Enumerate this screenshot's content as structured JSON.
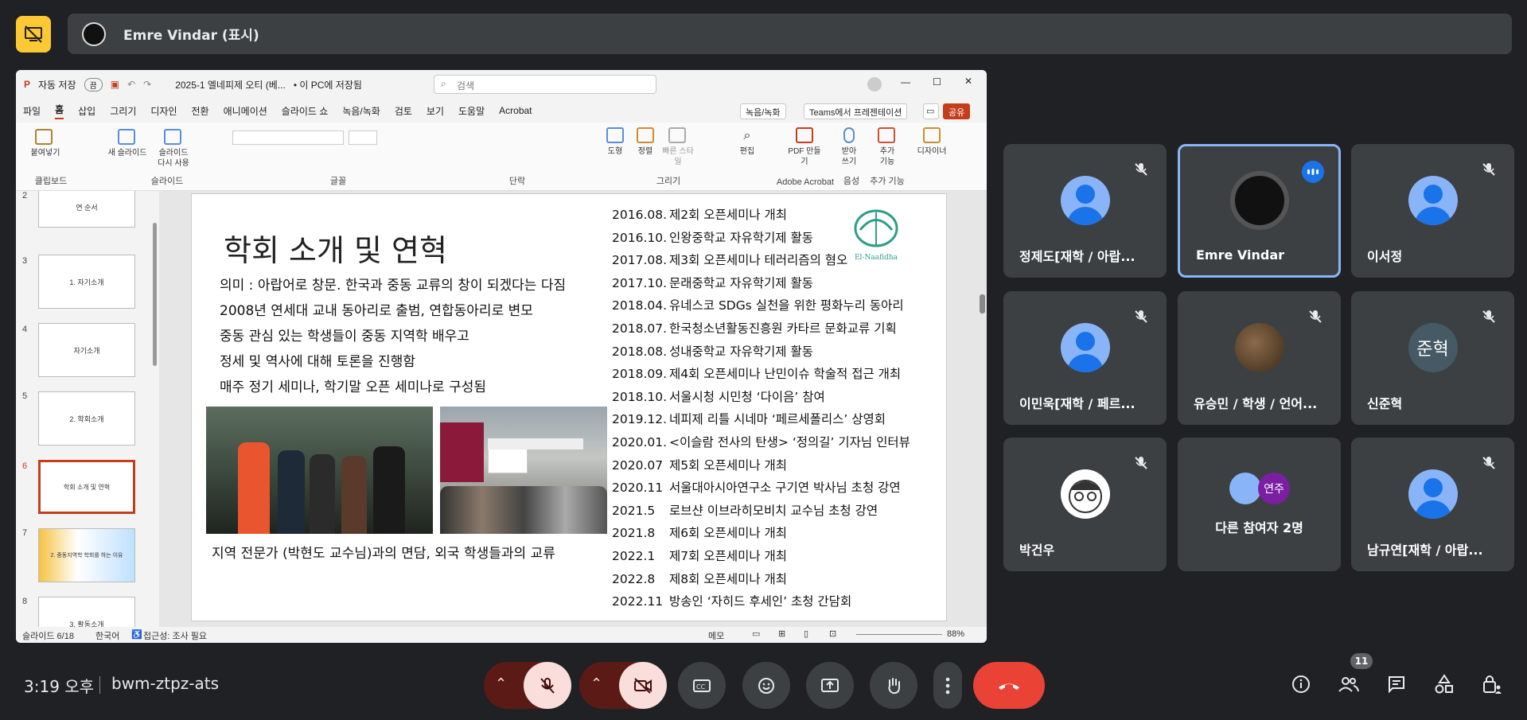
{
  "meeting": {
    "presenter_label": "Emre Vindar (표시)",
    "time": "3:19 오후",
    "code": "bwm-ztpz-ats",
    "participant_count": "11"
  },
  "ppt": {
    "autosave": "자동 저장",
    "autosave_toggle": "끔",
    "file_name": "2025-1 엘네피제 오티 (베...",
    "save_location": "• 이 PC에 저장됨",
    "search_placeholder": "검색",
    "menu": [
      "파일",
      "홈",
      "삽입",
      "그리기",
      "디자인",
      "전환",
      "애니메이션",
      "슬라이드 쇼",
      "녹음/녹화",
      "검토",
      "보기",
      "도움말",
      "Acrobat"
    ],
    "record_btn": "녹음/녹화",
    "teams_btn": "Teams에서 프레젠테이션",
    "share_btn": "공유",
    "ribbon": {
      "paste": "붙여넣기",
      "new_slide": "새 슬라이드",
      "reuse_slide": "슬라이드 다시 사용",
      "group_clipboard": "클립보드",
      "group_slide": "슬라이드",
      "group_font": "글꼴",
      "group_paragraph": "단락",
      "shapes": "도형",
      "arrange": "정렬",
      "quick_styles": "빠른 스타일",
      "group_drawing": "그리기",
      "editing": "편집",
      "pdf_share": "PDF 만들기",
      "group_acrobat": "Adobe Acrobat",
      "dictate": "받아 쓰기",
      "group_voice": "음성",
      "addins": "추가 기능",
      "group_addins": "추가 기능",
      "designer": "디자이너"
    },
    "thumbs": [
      {
        "num": "2",
        "text": "연 순서"
      },
      {
        "num": "3",
        "text": "1. 자기소개"
      },
      {
        "num": "4",
        "text": "자기소개"
      },
      {
        "num": "5",
        "text": "2. 학회소개"
      },
      {
        "num": "6",
        "text": "학회 소개 및 연혁"
      },
      {
        "num": "7",
        "text": "2. 중동지역학 학회를 하는 이유"
      },
      {
        "num": "8",
        "text": "3. 활동소개"
      }
    ],
    "status": {
      "slide": "슬라이드 6/18",
      "lang": "한국어",
      "access": "접근성: 조사 필요",
      "notes": "메모",
      "zoom": "88%"
    }
  },
  "slide": {
    "title": "학회 소개 및 연혁",
    "desc": [
      "의미 : 아랍어로 창문. 한국과 중동 교류의 창이 되겠다는 다짐",
      "2008년 연세대 교내 동아리로 출범, 연합동아리로 변모",
      "중동 관심 있는 학생들이 중동 지역학 배우고",
      "정세 및 역사에 대해 토론을 진행함",
      "매주 정기 세미나, 학기말 오픈 세미나로 구성됨"
    ],
    "caption": "지역 전문가 (박현도 교수님)과의 면담, 외국 학생들과의 교류",
    "logo_text": "El-Naafidha",
    "timeline": [
      {
        "date": "2016.08.",
        "event": "제2회 오픈세미나 개최"
      },
      {
        "date": "2016.10.",
        "event": "인왕중학교 자유학기제 활동"
      },
      {
        "date": "2017.08.",
        "event": "제3회 오픈세미나 테러리즘의 혐오"
      },
      {
        "date": "2017.10.",
        "event": "문래중학교 자유학기제 활동"
      },
      {
        "date": "2018.04.",
        "event": "유네스코 SDGs 실천을 위한 평화누리 동아리"
      },
      {
        "date": "2018.07.",
        "event": "한국청소년활동진흥원 카타르 문화교류 기획"
      },
      {
        "date": "2018.08.",
        "event": "성내중학교 자유학기제 활동"
      },
      {
        "date": "2018.09.",
        "event": "제4회 오픈세미나 난민이슈 학술적 접근 개최"
      },
      {
        "date": "2018.10.",
        "event": "서울시청 시민청 ‘다이음’ 참여"
      },
      {
        "date": "2019.12.",
        "event": "네피제 리틀 시네마 ‘페르세폴리스’ 상영회"
      },
      {
        "date": "2020.01.",
        "event": "<이슬람 전사의 탄생> ‘정의길’ 기자님 인터뷰"
      },
      {
        "date": "2020.07",
        "event": "제5회 오픈세미나 개최"
      },
      {
        "date": "2020.11",
        "event": "서울대아시아연구소 구기연 박사님 초청 강연"
      },
      {
        "date": "2021.5",
        "event": "로브샨 이브라히모비치 교수님 초청 강연"
      },
      {
        "date": "2021.8",
        "event": "제6회 오픈세미나 개최"
      },
      {
        "date": "2022.1",
        "event": "제7회 오픈세미나 개최"
      },
      {
        "date": "2022.8",
        "event": "제8회 오픈세미나 개최"
      },
      {
        "date": "2022.11",
        "event": "방송인 ‘자히드 후세인’ 초청 간담회"
      }
    ]
  },
  "participants": [
    {
      "name": "정제도[재학 / 아랍...",
      "muted": true
    },
    {
      "name": "Emre Vindar",
      "muted": false
    },
    {
      "name": "이서정",
      "muted": true
    },
    {
      "name": "이민욱[재학 / 페르...",
      "muted": true
    },
    {
      "name": "유승민 / 학생 / 언어...",
      "muted": true
    },
    {
      "name": "신준혁",
      "muted": true,
      "initial": "준혁"
    },
    {
      "name": "박건우",
      "muted": true
    },
    {
      "name": "다른 참여자 2명",
      "muted": false,
      "badge": "연주"
    },
    {
      "name": "남규연[재학 / 아랍...",
      "muted": true
    }
  ]
}
